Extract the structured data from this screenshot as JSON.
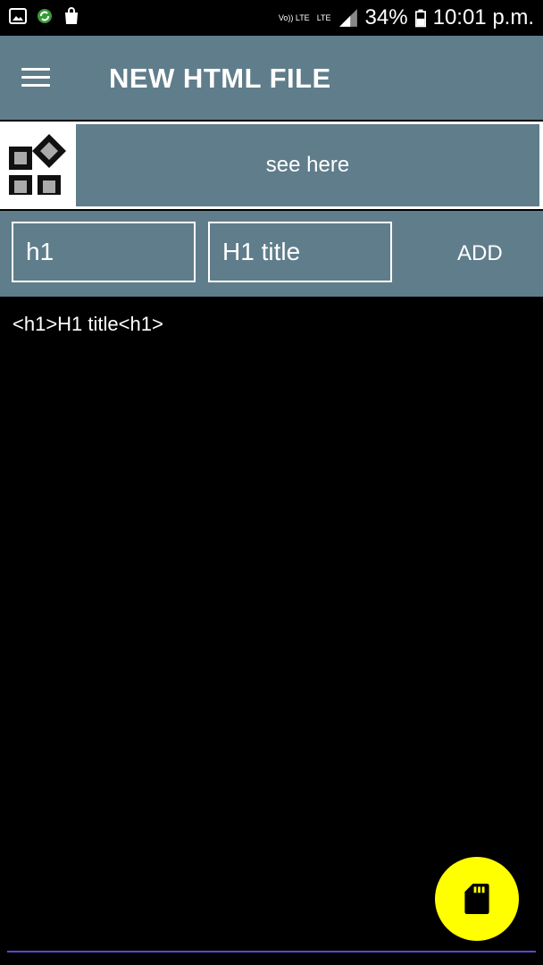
{
  "status_bar": {
    "lte_top": "Vo)) LTE",
    "lte_label": "LTE",
    "battery": "34%",
    "time": "10:01 p.m.",
    "icons": [
      "image-icon",
      "sync-icon",
      "shopping-bag-icon",
      "signal-icon",
      "battery-icon"
    ]
  },
  "toolbar": {
    "title": "NEW HTML FILE",
    "menu_icon": "hamburger-menu-icon"
  },
  "banner": {
    "icon": "app-grid-icon",
    "label": "see here"
  },
  "input_row": {
    "tag_value": "h1",
    "content_value": "H1 title",
    "add_label": "ADD"
  },
  "output": {
    "code": "<h1>H1 title<h1>"
  },
  "fab": {
    "icon": "sd-card-icon"
  },
  "colors": {
    "toolbar": "#607d8b",
    "fab": "#ffff00",
    "background": "#000000"
  }
}
